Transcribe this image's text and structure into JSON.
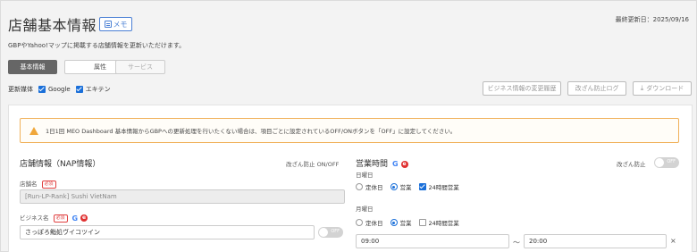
{
  "header": {
    "title": "店舗基本情報",
    "memo_label": "メモ",
    "last_updated": "最終更新日：2025/09/16",
    "subtitle": "GBPやYahoo!マップに掲載する店舗情報を更新いただけます。"
  },
  "tabs": [
    {
      "label": "基本情報",
      "state": "active"
    },
    {
      "label": "属性",
      "state": "normal"
    },
    {
      "label": "サービス",
      "state": "disabled"
    }
  ],
  "channels": {
    "label": "更新媒体",
    "items": [
      {
        "label": "Google",
        "checked": true
      },
      {
        "label": "エキテン",
        "checked": true
      }
    ]
  },
  "toolbar": {
    "change_history": "ビジネス情報の変更履歴",
    "tamper_log": "改ざん防止ログ",
    "download": "ダウンロード"
  },
  "alert": {
    "text": "1日1回 MEO Dashboard 基本情報からGBPへの更新処理を行いたくない場合は、項目ごとに設定されているOFF/ONボタンを「OFF」に設定してください。"
  },
  "store_info": {
    "title": "店舗情報（NAP情報）",
    "tamper_label": "改ざん防止 ON/OFF",
    "store_name_label": "店舗名",
    "required": "必須",
    "store_name_value": "[Run-LP-Rank] Sushi VietNam",
    "business_name_label": "ビジネス名",
    "business_name_value": "さっぽろ鮨処ヴイコツイン",
    "toggle_label": "OFF"
  },
  "hours": {
    "title": "営業時間",
    "tamper_label": "改ざん防止",
    "toggle_label": "OFF",
    "days": [
      {
        "label": "日曜日",
        "options": [
          "定休日",
          "営業",
          "24時間営業"
        ],
        "selected": "営業",
        "checked_24h": true
      },
      {
        "label": "月曜日",
        "options": [
          "定休日",
          "営業",
          "24時間営業"
        ],
        "selected": "営業",
        "checked_24h": false
      }
    ],
    "open_time": "09:00",
    "close_time": "20:00",
    "separator": "〜",
    "remove": "×"
  },
  "colors": {
    "accent": "#1a6fd9",
    "warning": "#f0a73a",
    "required": "#e04040"
  }
}
